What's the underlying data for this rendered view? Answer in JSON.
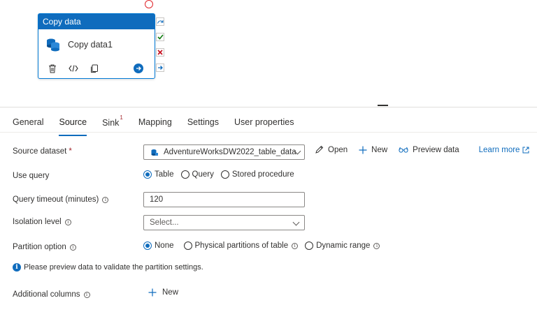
{
  "canvas": {
    "activity": {
      "header": "Copy data",
      "name": "Copy data1"
    }
  },
  "tabs": [
    {
      "label": "General"
    },
    {
      "label": "Source",
      "active": true
    },
    {
      "label": "Sink",
      "badge": "1"
    },
    {
      "label": "Mapping"
    },
    {
      "label": "Settings"
    },
    {
      "label": "User properties"
    }
  ],
  "form": {
    "source_dataset": {
      "label": "Source dataset",
      "required_mark": "*",
      "value": "AdventureWorksDW2022_table_data..."
    },
    "dataset_actions": {
      "open": "Open",
      "new": "New",
      "preview": "Preview data",
      "learn_more": "Learn more"
    },
    "use_query": {
      "label": "Use query",
      "options": [
        "Table",
        "Query",
        "Stored procedure"
      ],
      "selected": "Table"
    },
    "query_timeout": {
      "label": "Query timeout (minutes)",
      "value": "120"
    },
    "isolation_level": {
      "label": "Isolation level",
      "placeholder": "Select..."
    },
    "partition_option": {
      "label": "Partition option",
      "options": [
        "None",
        "Physical partitions of table",
        "Dynamic range"
      ],
      "selected": "None"
    },
    "notice": "Please preview data to validate the partition settings.",
    "additional_columns": {
      "label": "Additional columns",
      "new": "New"
    }
  },
  "colors": {
    "accent": "#0f6cbd",
    "error": "#a4262c",
    "success": "#107c10"
  }
}
